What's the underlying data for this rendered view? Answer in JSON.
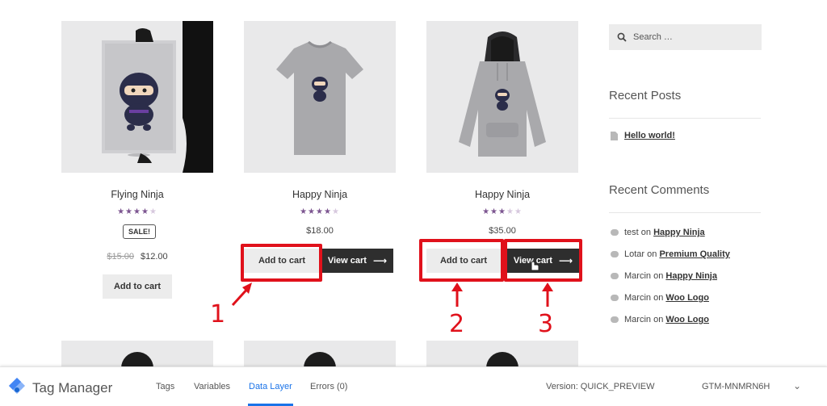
{
  "products": [
    {
      "title": "Flying Ninja",
      "rating": 4,
      "sale_badge": "SALE!",
      "price_old": "$15.00",
      "price": "$12.00",
      "button": "Add to cart"
    },
    {
      "title": "Happy Ninja",
      "rating": 4.5,
      "price": "$18.00",
      "button": "Add to cart",
      "view_cart": "View cart"
    },
    {
      "title": "Happy Ninja",
      "rating": 3,
      "price": "$35.00",
      "button": "Add to cart",
      "view_cart": "View cart"
    }
  ],
  "annotations": [
    "1",
    "2",
    "3"
  ],
  "sidebar": {
    "search_placeholder": "Search …",
    "recent_posts_title": "Recent Posts",
    "recent_posts": [
      "Hello world!"
    ],
    "recent_comments_title": "Recent Comments",
    "on_word": "on",
    "comments": [
      {
        "author": "test",
        "post": "Happy Ninja"
      },
      {
        "author": "Lotar",
        "post": "Premium Quality"
      },
      {
        "author": "Marcin",
        "post": "Happy Ninja"
      },
      {
        "author": "Marcin",
        "post": "Woo Logo"
      },
      {
        "author": "Marcin",
        "post": "Woo Logo"
      }
    ]
  },
  "tag_manager": {
    "title": "Tag Manager",
    "tabs": [
      "Tags",
      "Variables",
      "Data Layer",
      "Errors (0)"
    ],
    "active_tab": "Data Layer",
    "version": "Version: QUICK_PREVIEW",
    "container_id": "GTM-MNMRN6H"
  },
  "colors": {
    "star_filled": "#7c5590",
    "star_empty": "#d7c8de",
    "highlight_red": "#e0111b",
    "button_dark": "#2e2e2e",
    "button_light": "#ececec",
    "tm_active": "#1a73e8"
  }
}
